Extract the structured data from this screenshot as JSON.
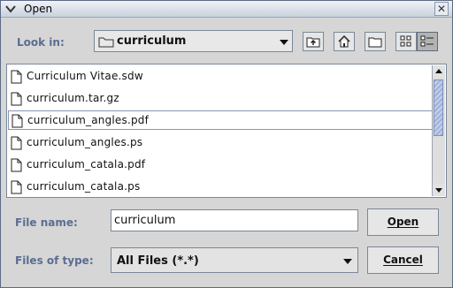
{
  "window": {
    "title": "Open",
    "close_glyph": "✕"
  },
  "look_in": {
    "label": "Look in:",
    "value": "curriculum",
    "icon": "folder-icon"
  },
  "toolbar": [
    {
      "name": "up-folder-button",
      "icon": "up-folder-icon"
    },
    {
      "name": "home-button",
      "icon": "home-icon"
    },
    {
      "name": "new-folder-button",
      "icon": "new-folder-icon"
    },
    {
      "name": "list-view-button",
      "icon": "list-view-icon"
    },
    {
      "name": "details-view-button",
      "icon": "details-view-icon",
      "pressed": true
    }
  ],
  "files": [
    {
      "name": "Curriculum Vitae.sdw"
    },
    {
      "name": "curriculum.tar.gz"
    },
    {
      "name": "curriculum_angles.pdf",
      "selected": true
    },
    {
      "name": "curriculum_angles.ps"
    },
    {
      "name": "curriculum_catala.pdf"
    },
    {
      "name": "curriculum_catala.ps"
    }
  ],
  "file_name": {
    "label": "File name:",
    "value": "curriculum"
  },
  "files_of_type": {
    "label": "Files of type:",
    "value": "All Files (*.*)"
  },
  "buttons": {
    "open": "Open",
    "cancel": "Cancel"
  },
  "colors": {
    "label_blue": "#5b6d91",
    "background": "#d6d6d6",
    "scroll_thumb": "#9fb0d8"
  }
}
